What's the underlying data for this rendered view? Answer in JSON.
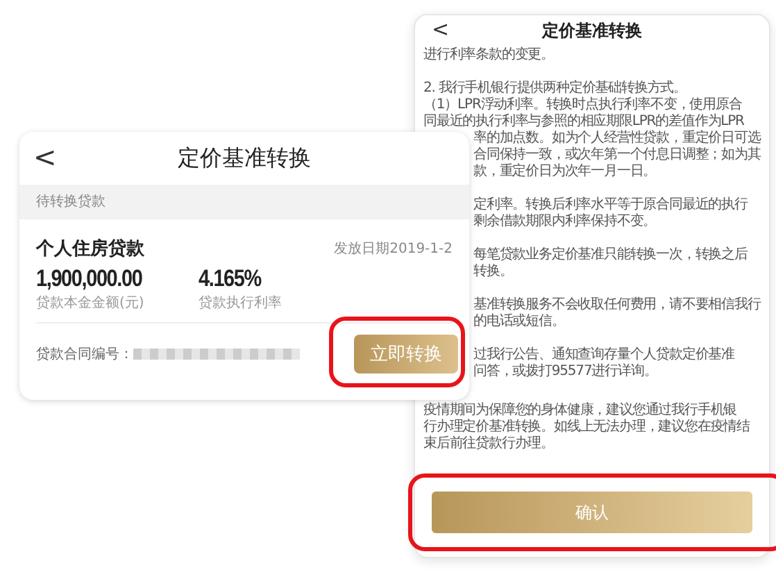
{
  "notice_page": {
    "back": "<",
    "title": "定价基准转换",
    "paragraphs": [
      {
        "lines": [
          {
            "text": "进行利率条款的变更。",
            "clipped": false
          }
        ]
      },
      {
        "lines": [
          {
            "text": "2. 我行手机银行提供两种定价基础转换方式。",
            "clipped": false
          },
          {
            "text": "（1）LPR浮动利率。转换时点执行利率不变，使用原合",
            "clipped": false
          },
          {
            "text": "同最近的执行利率与参照的相应期限LPR的差值作为LPR",
            "clipped": false
          },
          {
            "text": "率的加点数。如为个人经营性贷款，重定价日可选",
            "clipped": true
          },
          {
            "text": "合同保持一致，或次年第一个付息日调整；如为其",
            "clipped": true
          },
          {
            "text": "款，重定价日为次年一月一日。",
            "clipped": true
          }
        ]
      },
      {
        "lines": [
          {
            "text": "定利率。转换后利率水平等于原合同最近的执行",
            "clipped": true
          },
          {
            "text": "剩余借款期限内利率保持不变。",
            "clipped": true
          }
        ]
      },
      {
        "lines": [
          {
            "text": "每笔贷款业务定价基准只能转换一次，转换之后",
            "clipped": true
          },
          {
            "text": "转换。",
            "clipped": true
          }
        ]
      },
      {
        "lines": [
          {
            "text": "基准转换服务不会收取任何费用，请不要相信我行",
            "clipped": true
          },
          {
            "text": "的电话或短信。",
            "clipped": true
          }
        ]
      },
      {
        "lines": [
          {
            "text": "过我行公告、通知查询存量个人贷款定价基准",
            "clipped": true
          },
          {
            "text": "问答，或拨打95577进行详询。",
            "clipped": true
          }
        ]
      },
      {
        "lines": [
          {
            "text": "疫情期间为保障您的身体健康，建议您通过我行手机银",
            "clipped": false
          },
          {
            "text": "行办理定价基准转换。如线上无法办理，建议您在疫情结",
            "clipped": false
          },
          {
            "text": "束后前往贷款行办理。",
            "clipped": false
          }
        ]
      }
    ],
    "confirm_button": {
      "label": "确认",
      "highlighted": true
    }
  },
  "loan_page": {
    "back": "<",
    "title": "定价基准转换",
    "section": "待转换贷款",
    "loan": {
      "name": "个人住房贷款",
      "issue_date": "发放日期2019-1-2",
      "figures": [
        {
          "value": "1,900,000.00",
          "label": "贷款本金金额(元)"
        },
        {
          "value": "4.165%",
          "label": "贷款执行利率"
        }
      ],
      "contract_label": "贷款合同编号：",
      "contract_redacted": true
    },
    "convert_button": {
      "label": "立即转换",
      "highlighted": true
    }
  }
}
